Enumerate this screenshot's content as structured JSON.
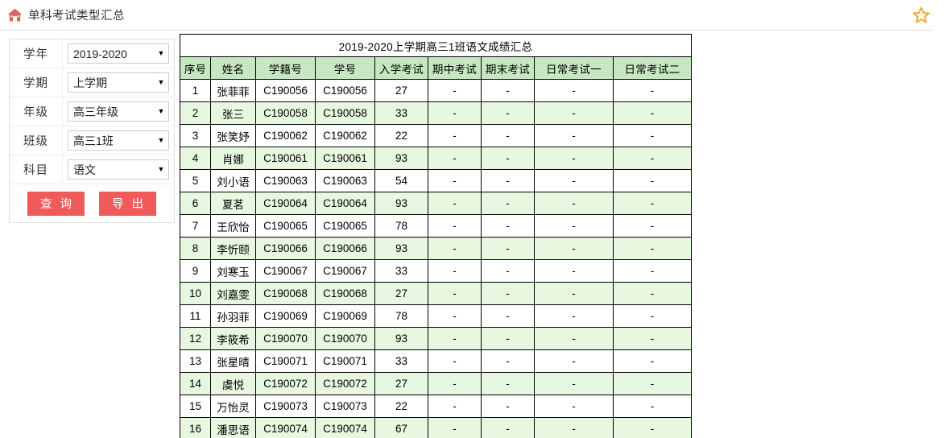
{
  "header": {
    "home_icon": "home-icon",
    "breadcrumb": "单科考试类型汇总",
    "favorite_icon": "star-outline-icon",
    "accent_red": "#ef5b5b",
    "star_color": "#f5a623"
  },
  "filters": {
    "rows": [
      {
        "label": "学年",
        "value": "2019-2020",
        "name": "school-year"
      },
      {
        "label": "学期",
        "value": "上学期",
        "name": "semester"
      },
      {
        "label": "年级",
        "value": "高三年级",
        "name": "grade"
      },
      {
        "label": "班级",
        "value": "高三1班",
        "name": "class"
      },
      {
        "label": "科目",
        "value": "语文",
        "name": "subject"
      }
    ],
    "query_button": "查 询",
    "export_button": "导 出",
    "dropdown_arrow": "▼"
  },
  "report": {
    "title": "2019-2020上学期高三1班语文成绩汇总",
    "title_color": "#ff0000",
    "header_bg": "#c6e8c0",
    "alt_row_bg": "#e8f8e0",
    "columns": [
      "序号",
      "姓名",
      "学籍号",
      "学号",
      "入学考试",
      "期中考试",
      "期末考试",
      "日常考试一",
      "日常考试二"
    ],
    "rows": [
      {
        "seq": "1",
        "name": "张菲菲",
        "reg": "C190056",
        "sid": "C190056",
        "entrance": "27",
        "midterm": "-",
        "final": "-",
        "daily1": "-",
        "daily2": "-"
      },
      {
        "seq": "2",
        "name": "张三",
        "reg": "C190058",
        "sid": "C190058",
        "entrance": "33",
        "midterm": "-",
        "final": "-",
        "daily1": "-",
        "daily2": "-"
      },
      {
        "seq": "3",
        "name": "张笑妤",
        "reg": "C190062",
        "sid": "C190062",
        "entrance": "22",
        "midterm": "-",
        "final": "-",
        "daily1": "-",
        "daily2": "-"
      },
      {
        "seq": "4",
        "name": "肖娜",
        "reg": "C190061",
        "sid": "C190061",
        "entrance": "93",
        "midterm": "-",
        "final": "-",
        "daily1": "-",
        "daily2": "-"
      },
      {
        "seq": "5",
        "name": "刘小语",
        "reg": "C190063",
        "sid": "C190063",
        "entrance": "54",
        "midterm": "-",
        "final": "-",
        "daily1": "-",
        "daily2": "-"
      },
      {
        "seq": "6",
        "name": "夏茗",
        "reg": "C190064",
        "sid": "C190064",
        "entrance": "93",
        "midterm": "-",
        "final": "-",
        "daily1": "-",
        "daily2": "-"
      },
      {
        "seq": "7",
        "name": "王欣怡",
        "reg": "C190065",
        "sid": "C190065",
        "entrance": "78",
        "midterm": "-",
        "final": "-",
        "daily1": "-",
        "daily2": "-"
      },
      {
        "seq": "8",
        "name": "李忻颐",
        "reg": "C190066",
        "sid": "C190066",
        "entrance": "93",
        "midterm": "-",
        "final": "-",
        "daily1": "-",
        "daily2": "-"
      },
      {
        "seq": "9",
        "name": "刘寒玉",
        "reg": "C190067",
        "sid": "C190067",
        "entrance": "33",
        "midterm": "-",
        "final": "-",
        "daily1": "-",
        "daily2": "-"
      },
      {
        "seq": "10",
        "name": "刘嘉雯",
        "reg": "C190068",
        "sid": "C190068",
        "entrance": "27",
        "midterm": "-",
        "final": "-",
        "daily1": "-",
        "daily2": "-"
      },
      {
        "seq": "11",
        "name": "孙羽菲",
        "reg": "C190069",
        "sid": "C190069",
        "entrance": "78",
        "midterm": "-",
        "final": "-",
        "daily1": "-",
        "daily2": "-"
      },
      {
        "seq": "12",
        "name": "李筱希",
        "reg": "C190070",
        "sid": "C190070",
        "entrance": "93",
        "midterm": "-",
        "final": "-",
        "daily1": "-",
        "daily2": "-"
      },
      {
        "seq": "13",
        "name": "张星晴",
        "reg": "C190071",
        "sid": "C190071",
        "entrance": "33",
        "midterm": "-",
        "final": "-",
        "daily1": "-",
        "daily2": "-"
      },
      {
        "seq": "14",
        "name": "虞悦",
        "reg": "C190072",
        "sid": "C190072",
        "entrance": "27",
        "midterm": "-",
        "final": "-",
        "daily1": "-",
        "daily2": "-"
      },
      {
        "seq": "15",
        "name": "万怡灵",
        "reg": "C190073",
        "sid": "C190073",
        "entrance": "22",
        "midterm": "-",
        "final": "-",
        "daily1": "-",
        "daily2": "-"
      },
      {
        "seq": "16",
        "name": "潘思语",
        "reg": "C190074",
        "sid": "C190074",
        "entrance": "67",
        "midterm": "-",
        "final": "-",
        "daily1": "-",
        "daily2": "-"
      }
    ]
  }
}
